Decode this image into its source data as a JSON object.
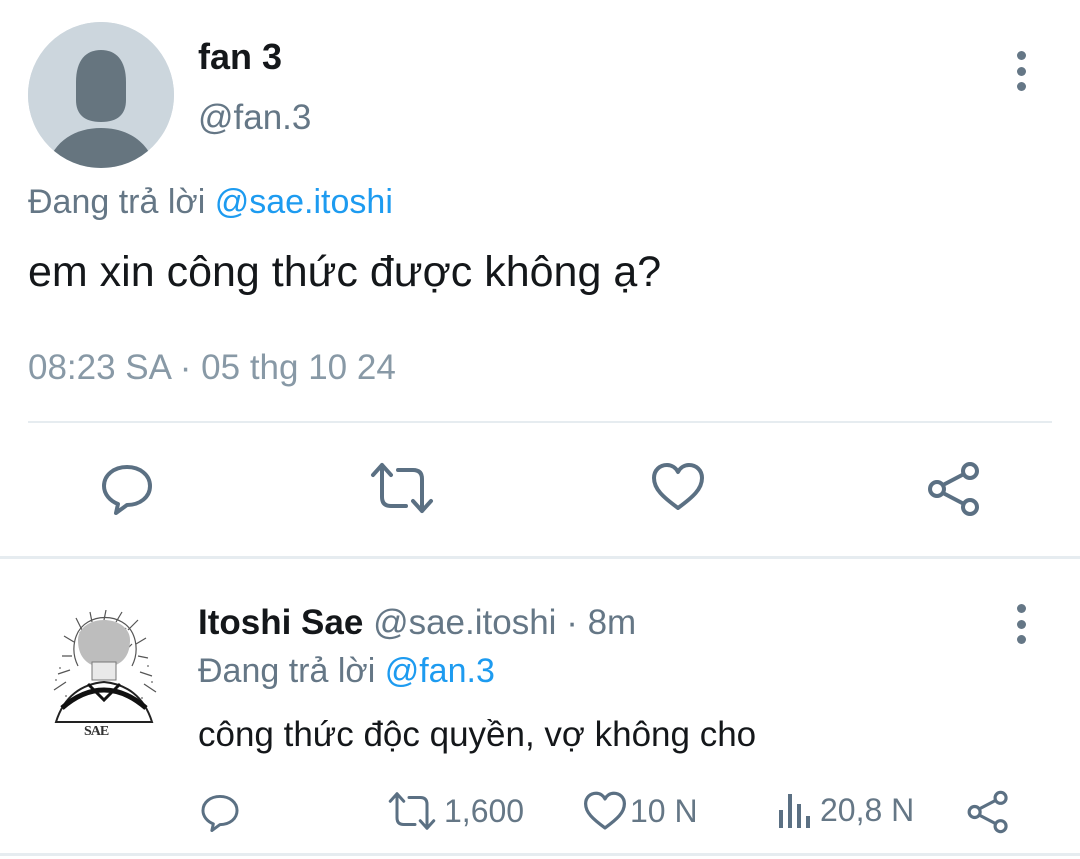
{
  "tweet": {
    "display_name": "fan 3",
    "handle": "@fan.3",
    "replying_prefix": "Đang trả lời",
    "replying_to": "@sae.itoshi",
    "text": "em xin công thức được không ạ?",
    "timestamp": "08:23 SA · 05 thg 10 24",
    "actions": {
      "reply_icon": "comment-icon",
      "retweet_icon": "retweet-icon",
      "like_icon": "heart-icon",
      "share_icon": "share-icon"
    }
  },
  "reply": {
    "display_name": "Itoshi Sae",
    "handle": "@sae.itoshi",
    "separator": "·",
    "age": "8m",
    "replying_prefix": "Đang trả lời",
    "replying_to": "@fan.3",
    "text": "công thức độc quyền, vợ không cho",
    "avatar_caption": "SAE",
    "retweets": "1,600",
    "likes": "10 N",
    "views": "20,8 N"
  },
  "colors": {
    "accent": "#1d9bf0",
    "muted": "#657786",
    "icon": "#5b7083",
    "divider": "#e6ecf0"
  }
}
